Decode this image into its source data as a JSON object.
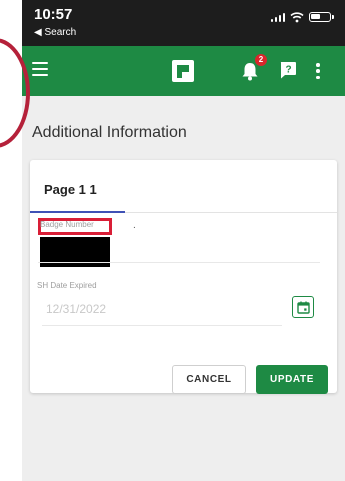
{
  "status_bar": {
    "time": "10:57",
    "back_label": "◀ Search"
  },
  "app_bar": {
    "notification_count": "2",
    "icons": [
      "menu-icon",
      "app-logo-icon",
      "bell-icon",
      "help-icon",
      "more-vert-icon"
    ]
  },
  "page": {
    "title": "Additional Information"
  },
  "card": {
    "tab_label": "Page 1 1",
    "badge_field": {
      "label": "Badge Number",
      "value": "."
    },
    "sh_field": {
      "label": "SH Date Expired",
      "value": "12/31/2022"
    },
    "buttons": {
      "cancel": "CANCEL",
      "update": "UPDATE"
    }
  },
  "colors": {
    "app_green": "#1e8a44",
    "annotation_red": "#d91e36",
    "tab_indicator": "#3f51b5",
    "badge_red": "#d9262c"
  }
}
